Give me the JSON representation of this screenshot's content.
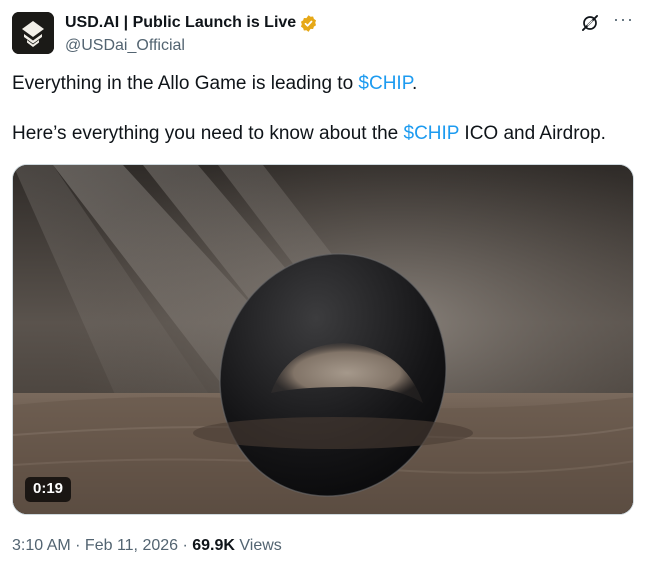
{
  "author": {
    "display_name": "USD.AI | Public Launch is Live",
    "handle": "@USDai_Official",
    "verified_badge": "gold-verified-icon",
    "accent": "#e6a817"
  },
  "top_actions": {
    "grok_icon": "grok-icon",
    "more_icon": "more-icon",
    "more_glyph": "···"
  },
  "tweet": {
    "line1_before": "Everything in the Allo Game is leading to ",
    "line1_cashtag": "$CHIP",
    "line1_after": ".",
    "line2_before": "Here’s everything you need to know about the ",
    "line2_cashtag": "$CHIP",
    "line2_after": " ICO and Airdrop."
  },
  "media": {
    "type": "video",
    "duration": "0:19"
  },
  "meta": {
    "time": "3:10 AM",
    "separator": " · ",
    "date": "Feb 11, 2026",
    "views_count": "69.9K",
    "views_label": " Views"
  },
  "colors": {
    "link": "#1d9bf0",
    "secondary_text": "#536471",
    "primary_text": "#0f1419"
  }
}
